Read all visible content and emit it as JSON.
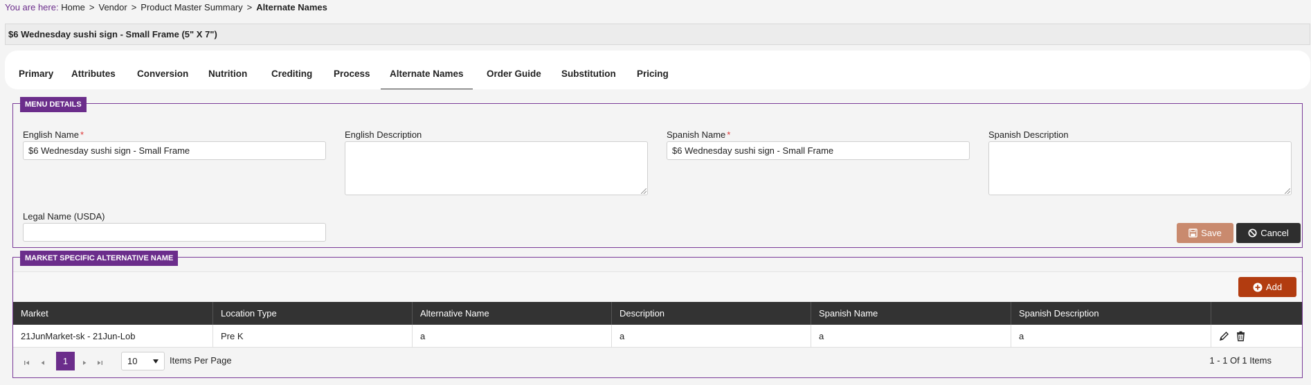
{
  "breadcrumb": {
    "prefix": "You are here:",
    "items": [
      "Home",
      "Vendor",
      "Product Master Summary"
    ],
    "current": "Alternate Names",
    "separator": ">"
  },
  "product_title": "$6 Wednesday sushi sign - Small Frame (5\" X 7\")",
  "tabs": [
    {
      "label": "Primary"
    },
    {
      "label": "Attributes"
    },
    {
      "label": "Conversion"
    },
    {
      "label": "Nutrition"
    },
    {
      "label": "Crediting"
    },
    {
      "label": "Process"
    },
    {
      "label": "Alternate Names",
      "active": true
    },
    {
      "label": "Order Guide"
    },
    {
      "label": "Substitution"
    },
    {
      "label": "Pricing"
    }
  ],
  "menu_details": {
    "legend": "MENU DETAILS",
    "english_name_label": "English Name",
    "english_name_value": "$6 Wednesday sushi sign - Small Frame",
    "english_description_label": "English Description",
    "spanish_name_label": "Spanish Name",
    "spanish_name_value": "$6 Wednesday sushi sign - Small Frame",
    "spanish_description_label": "Spanish Description",
    "legal_name_label": "Legal Name (USDA)",
    "legal_name_value": "",
    "required_marker": "*",
    "save_label": "Save",
    "cancel_label": "Cancel"
  },
  "market_section": {
    "legend": "MARKET SPECIFIC ALTERNATIVE NAME",
    "add_label": "Add",
    "columns": [
      "Market",
      "Location Type",
      "Alternative Name",
      "Description",
      "Spanish Name",
      "Spanish Description"
    ],
    "rows": [
      {
        "market": "21JunMarket-sk - 21Jun-Lob",
        "location_type": "Pre K",
        "alternative_name": "a",
        "description": "a",
        "spanish_name": "a",
        "spanish_description": "a"
      }
    ],
    "pager": {
      "current_page": "1",
      "page_size": "10",
      "items_per_page_label": "Items Per Page",
      "summary": "1 - 1 Of 1 Items"
    }
  },
  "colors": {
    "accent_purple": "#6b2d8b",
    "header_dark": "#333333",
    "save_button": "#c98a6e",
    "add_button": "#b23c10"
  }
}
